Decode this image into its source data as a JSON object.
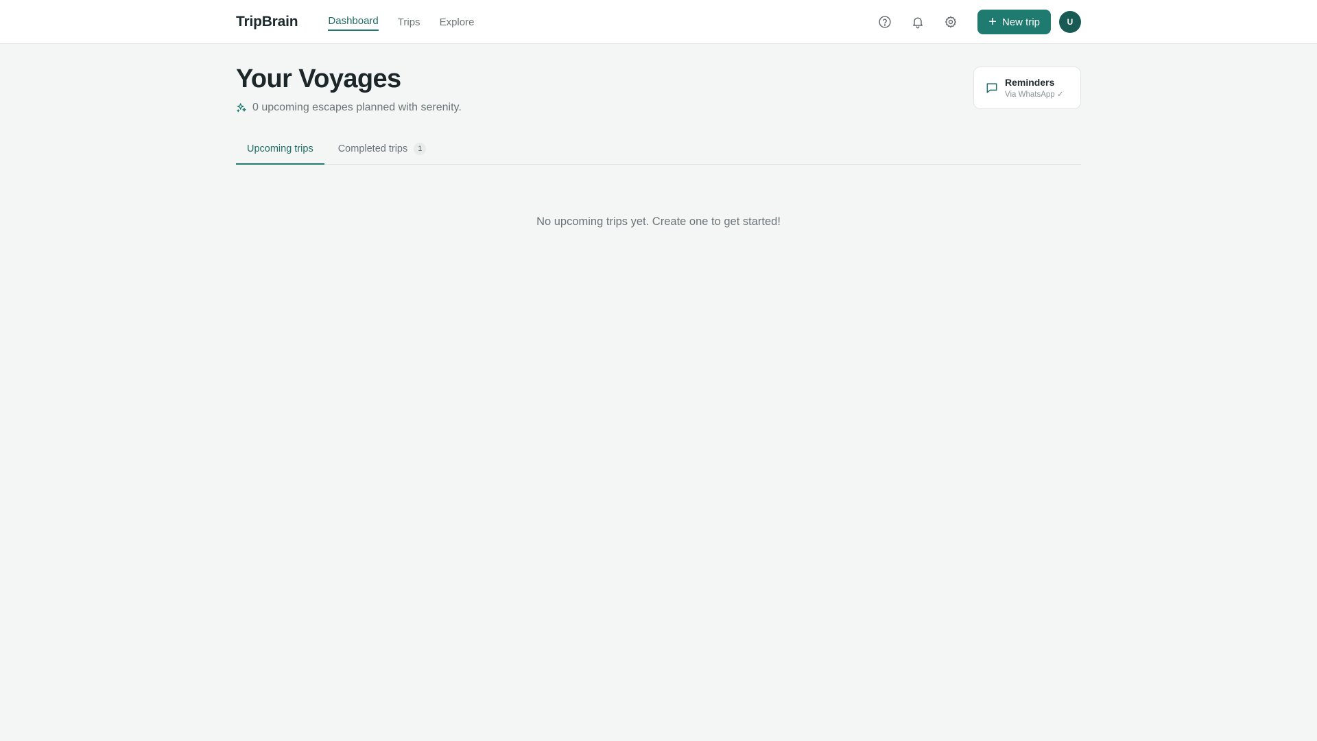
{
  "app": {
    "brand": "TripBrain"
  },
  "nav": {
    "links": [
      {
        "label": "Dashboard",
        "active": true
      },
      {
        "label": "Trips",
        "active": false
      },
      {
        "label": "Explore",
        "active": false
      }
    ]
  },
  "header_actions": {
    "icons": [
      "help-circle-icon",
      "bell-icon",
      "gear-icon"
    ],
    "new_trip_label": "New trip",
    "avatar_initial": "U"
  },
  "page": {
    "title": "Your Voyages",
    "subtitle": "0 upcoming escapes planned with serenity."
  },
  "reminders": {
    "title": "Reminders",
    "subtitle": "Via WhatsApp ✓"
  },
  "tabs": [
    {
      "label": "Upcoming trips",
      "active": true
    },
    {
      "label": "Completed trips",
      "count": "1",
      "active": false
    }
  ],
  "empty_state": {
    "message": "No upcoming trips yet. Create one to get started!"
  },
  "colors": {
    "accent": "#1f7a6f",
    "background": "#f3f6f5",
    "avatar": "#1a5a55"
  }
}
